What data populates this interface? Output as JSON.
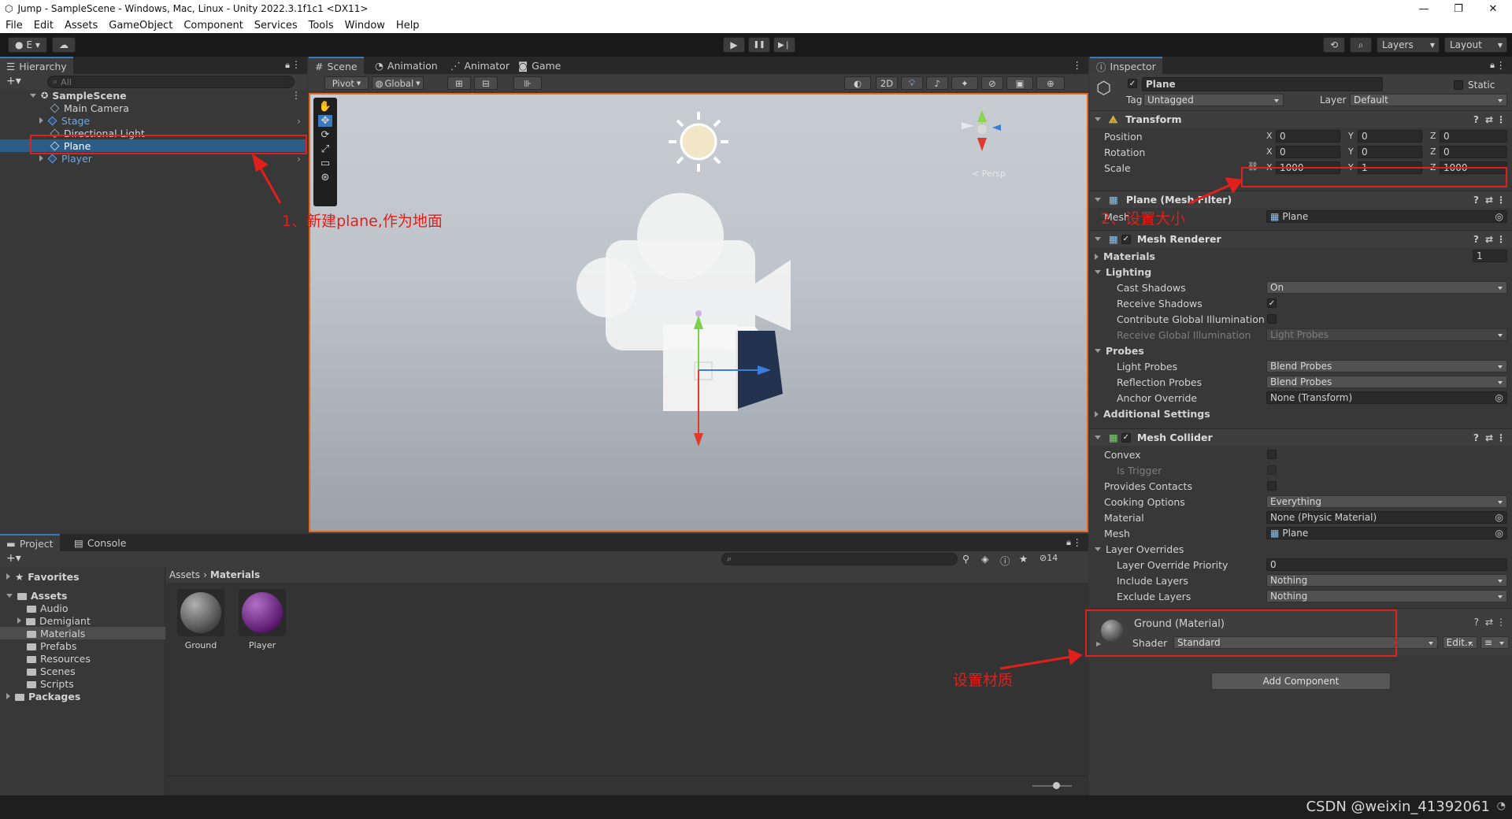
{
  "window": {
    "title": "Jump - SampleScene - Windows, Mac, Linux - Unity 2022.3.1f1c1 <DX11>",
    "minimize": "—",
    "maximize": "❐",
    "close": "✕"
  },
  "menu": [
    "File",
    "Edit",
    "Assets",
    "GameObject",
    "Component",
    "Services",
    "Tools",
    "Window",
    "Help"
  ],
  "toolbar": {
    "account": "E ▾",
    "layers": "Layers",
    "layout": "Layout",
    "play": "▶",
    "pause": "❚❚",
    "step": "▶❘"
  },
  "hierarchy": {
    "tab": "Hierarchy",
    "search_placeholder": "All",
    "scene": "SampleScene",
    "items": [
      {
        "label": "Main Camera"
      },
      {
        "label": "Stage"
      },
      {
        "label": "Directional Light"
      },
      {
        "label": "Plane"
      },
      {
        "label": "Player"
      }
    ]
  },
  "scene_view": {
    "tabs": [
      "Scene",
      "Animation",
      "Animator",
      "Game"
    ],
    "pivot": "Pivot",
    "global": "Global",
    "mode_2d": "2D",
    "persp": "< Persp"
  },
  "inspector": {
    "tab": "Inspector",
    "object_name": "Plane",
    "static_label": "Static",
    "tag_label": "Tag",
    "tag_value": "Untagged",
    "layer_label": "Layer",
    "layer_value": "Default",
    "transform": {
      "title": "Transform",
      "position_label": "Position",
      "position": [
        "0",
        "0",
        "0"
      ],
      "rotation_label": "Rotation",
      "rotation": [
        "0",
        "0",
        "0"
      ],
      "scale_label": "Scale",
      "scale": [
        "1000",
        "1",
        "1000"
      ]
    },
    "mesh_filter": {
      "title": "Plane (Mesh Filter)",
      "mesh_label": "Mesh",
      "mesh_value": "Plane"
    },
    "mesh_renderer": {
      "title": "Mesh Renderer",
      "materials_label": "Materials",
      "materials_count": "1",
      "lighting_label": "Lighting",
      "cast_shadows_label": "Cast Shadows",
      "cast_shadows_value": "On",
      "receive_shadows_label": "Receive Shadows",
      "contribute_gi_label": "Contribute Global Illumination",
      "receive_gi_label": "Receive Global Illumination",
      "receive_gi_value": "Light Probes",
      "probes_label": "Probes",
      "light_probes_label": "Light Probes",
      "light_probes_value": "Blend Probes",
      "reflection_probes_label": "Reflection Probes",
      "reflection_probes_value": "Blend Probes",
      "anchor_override_label": "Anchor Override",
      "anchor_override_value": "None (Transform)",
      "additional_settings_label": "Additional Settings"
    },
    "mesh_collider": {
      "title": "Mesh Collider",
      "convex_label": "Convex",
      "is_trigger_label": "Is Trigger",
      "provides_contacts_label": "Provides Contacts",
      "cooking_options_label": "Cooking Options",
      "cooking_options_value": "Everything",
      "material_label": "Material",
      "material_value": "None (Physic Material)",
      "mesh_label": "Mesh",
      "mesh_value": "Plane",
      "layer_overrides_label": "Layer Overrides",
      "layer_override_priority_label": "Layer Override Priority",
      "layer_override_priority_value": "0",
      "include_layers_label": "Include Layers",
      "include_layers_value": "Nothing",
      "exclude_layers_label": "Exclude Layers",
      "exclude_layers_value": "Nothing"
    },
    "material": {
      "title": "Ground (Material)",
      "shader_label": "Shader",
      "shader_value": "Standard",
      "edit_label": "Edit..."
    },
    "add_component": "Add Component"
  },
  "project": {
    "tabs": [
      "Project",
      "Console"
    ],
    "favorites": "Favorites",
    "assets_label": "Assets",
    "folders": [
      "Audio",
      "Demigiant",
      "Materials",
      "Prefabs",
      "Resources",
      "Scenes",
      "Scripts"
    ],
    "packages": "Packages",
    "breadcrumb": [
      "Assets",
      "Materials"
    ],
    "hidden_count": "14",
    "items": [
      {
        "name": "Ground",
        "color": "#6a6a6a"
      },
      {
        "name": "Player",
        "color": "#6a1f7a"
      }
    ]
  },
  "annotations": {
    "a1": "1、新建plane,作为地面",
    "a2": "2、设置大小",
    "a3": "设置材质"
  },
  "watermark": "CSDN @weixin_41392061",
  "colors": {
    "selection": "#2c5d87",
    "annotation_red": "#e0201c",
    "accent_blue": "#3a79bb"
  }
}
